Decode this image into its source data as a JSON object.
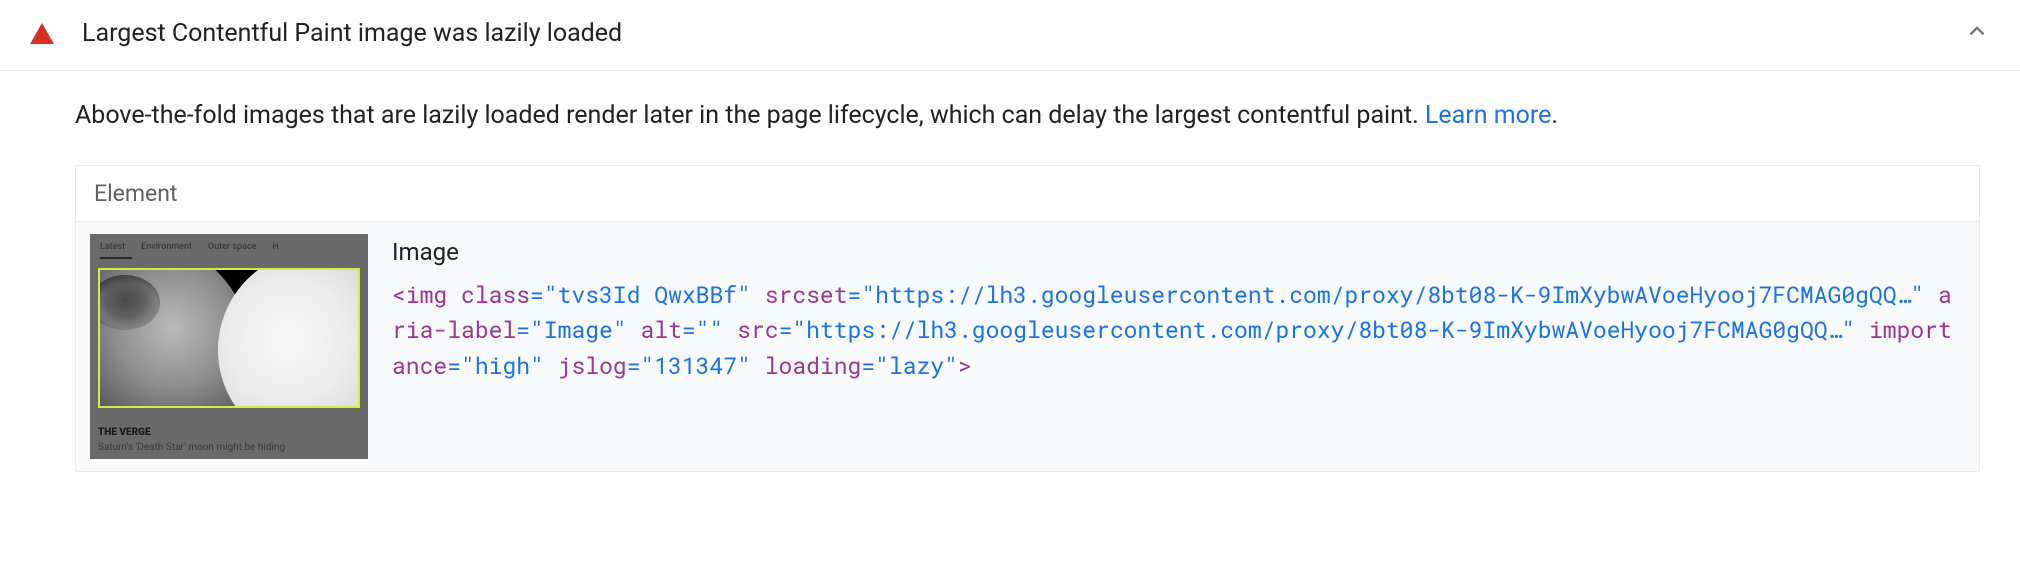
{
  "audit": {
    "title": "Largest Contentful Paint image was lazily loaded",
    "description_prefix": "Above-the-fold images that are lazily loaded render later in the page lifecycle, which can delay the largest contentful paint. ",
    "learn_more_label": "Learn more",
    "description_suffix": "."
  },
  "table": {
    "header": "Element"
  },
  "element": {
    "label": "Image",
    "code": {
      "tag_open": "<img",
      "attr_class": "class",
      "val_class": "\"tvs3Id QwxBBf\"",
      "attr_srcset": "srcset",
      "val_srcset": "\"https://lh3.googleusercontent.com/proxy/8bt08-K-9ImXybwAVoeHyooj7FCMAG0gQQ…\"",
      "attr_arialabel": "aria-label",
      "val_arialabel": "\"Image\"",
      "attr_alt": "alt",
      "val_alt": "\"\"",
      "attr_src": "src",
      "val_src": "\"https://lh3.googleusercontent.com/proxy/8bt08-K-9ImXybwAVoeHyooj7FCMAG0gQQ…\"",
      "attr_importance": "importance",
      "val_importance": "\"high\"",
      "attr_jslog": "jslog",
      "val_jslog": "\"131347\"",
      "attr_loading": "loading",
      "val_loading": "\"lazy\"",
      "tag_close": ">"
    }
  },
  "thumbnail": {
    "nav": {
      "item1": "Latest",
      "item2": "Environment",
      "item3": "Outer space",
      "item4": "H"
    },
    "brand": "THE VERGE",
    "caption": "Saturn's 'Death Star' moon might be hiding"
  }
}
